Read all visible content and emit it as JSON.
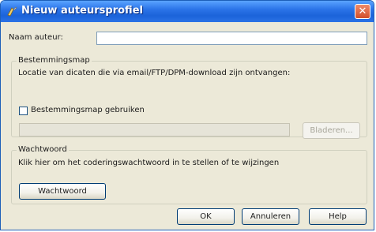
{
  "window": {
    "title": "Nieuw auteursprofiel",
    "close_glyph": "✕",
    "icon": "app-icon"
  },
  "author": {
    "label": "Naam auteur:",
    "value": ""
  },
  "destination": {
    "group_title": "Bestemmingsmap",
    "description": "Locatie van dicaten die via email/FTP/DPM-download zijn ontvangen:",
    "checkbox_label": "Bestemmingsmap gebruiken",
    "checkbox_checked": false,
    "path_value": "",
    "browse_label": "Bladeren..."
  },
  "password": {
    "group_title": "Wachtwoord",
    "description": "Klik hier om het coderingswachtwoord in te stellen of te wijzingen",
    "button_label": "Wachtwoord"
  },
  "footer": {
    "ok_label": "OK",
    "cancel_label": "Annuleren",
    "help_label": "Help"
  }
}
